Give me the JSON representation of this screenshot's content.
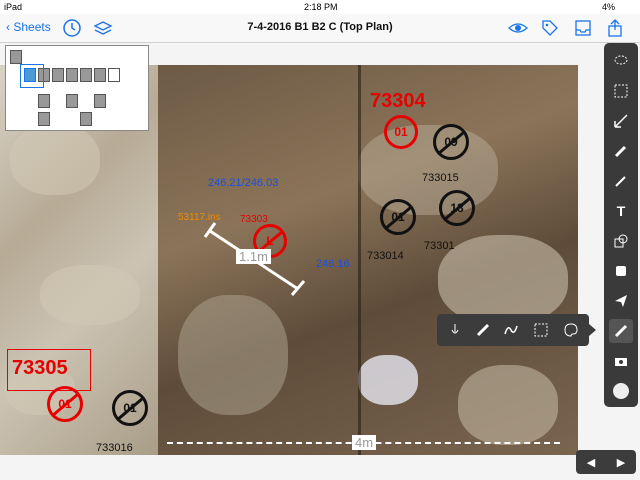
{
  "status_bar": {
    "device": "iPad",
    "time": "2:18 PM",
    "battery": "4%"
  },
  "toolbar": {
    "back_label": "Sheets",
    "title": "7-4-2016 B1 B2 C (Top Plan)",
    "left_icons": [
      "clock-icon",
      "layers-icon"
    ],
    "right_icons": [
      "eye-icon",
      "tag-icon",
      "inbox-icon",
      "share-icon"
    ]
  },
  "map": {
    "labels_red": [
      {
        "text": "73304",
        "size": "big"
      },
      {
        "text": "73305",
        "size": "big"
      },
      {
        "text": "73303",
        "size": "small"
      }
    ],
    "labels_blue": [
      "246.21/246.03",
      "246.16"
    ],
    "labels_orange": [
      "53117.ins"
    ],
    "labels_black": [
      "733015",
      "733014",
      "73301",
      "733016"
    ],
    "measure_main": "1.1m",
    "measure_bottom": "4m",
    "circles": [
      {
        "text": "01",
        "color": "red",
        "struck": false
      },
      {
        "text": "09",
        "color": "black",
        "struck": true
      },
      {
        "text": "01",
        "color": "black",
        "struck": true
      },
      {
        "text": "18",
        "color": "black",
        "struck": true
      },
      {
        "text": "L",
        "color": "red",
        "struck": true
      },
      {
        "text": "01",
        "color": "red",
        "struck": true
      },
      {
        "text": "01",
        "color": "black",
        "struck": true
      }
    ]
  },
  "right_toolbar": {
    "tools": [
      "lasso-icon",
      "select-rect-icon",
      "arrow-icon",
      "pencil-icon",
      "highlighter-icon",
      "text-icon",
      "shapes-icon",
      "stamp-icon",
      "send-icon",
      "ruler-icon",
      "camera-icon",
      "color-dot-icon"
    ]
  },
  "popup_tools": {
    "tools": [
      "finger-draw-icon",
      "ruler-measure-icon",
      "freehand-icon",
      "marquee-icon",
      "palette-icon"
    ]
  },
  "nav_arrows": {
    "prev_label": "◀",
    "next_label": "▶"
  }
}
